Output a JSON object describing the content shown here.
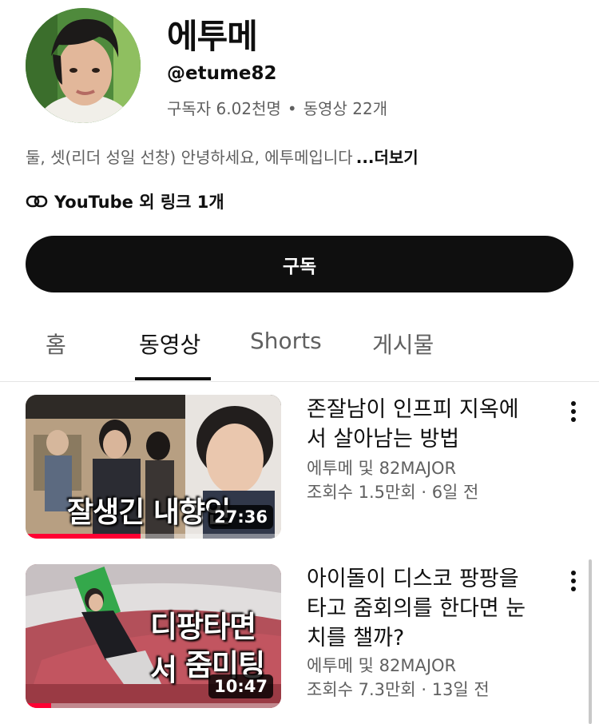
{
  "channel": {
    "name": "에투메",
    "handle": "@etume82",
    "subscribers": "구독자 6.02천명",
    "separator": "•",
    "video_count": "동영상 22개",
    "description": "둘, 셋(리더 성일 선창) 안녕하세요, 에투메입니다",
    "more_label": "...더보기",
    "links_label": "YouTube 외 링크 1개",
    "link_icon": "link-icon",
    "avatar_icon": "avatar"
  },
  "subscribe_label": "구독",
  "tabs": [
    {
      "label": "홈",
      "active": false
    },
    {
      "label": "동영상",
      "active": true
    },
    {
      "label": "Shorts",
      "active": false
    },
    {
      "label": "게시물",
      "active": false
    }
  ],
  "videos": [
    {
      "title_line1": "존잘남이 인프피 지옥에",
      "title_line2": "서 살아남는 방법",
      "title_line3": "",
      "author": "에투메 및 82MAJOR",
      "meta": "조회수 1.5만회 · 6일 전",
      "thumb_text": "잘생긴 내향인",
      "duration": "27:36",
      "watched_fraction": 0.45
    },
    {
      "title_line1": "아이돌이 디스코 팡팡을",
      "title_line2": "타고 줌회의를 한다면 눈",
      "title_line3": "치를 챌까?",
      "author": "에투메 및 82MAJOR",
      "meta": "조회수 7.3만회 · 13일 전",
      "thumb_text_line1": "디팡타면서",
      "thumb_text_line2": "줌미팅",
      "duration": "10:47",
      "watched_fraction": 0.1
    }
  ],
  "colors": {
    "accent": "#ff0033",
    "button_bg": "#0f0f0f",
    "secondary_text": "#606060"
  }
}
